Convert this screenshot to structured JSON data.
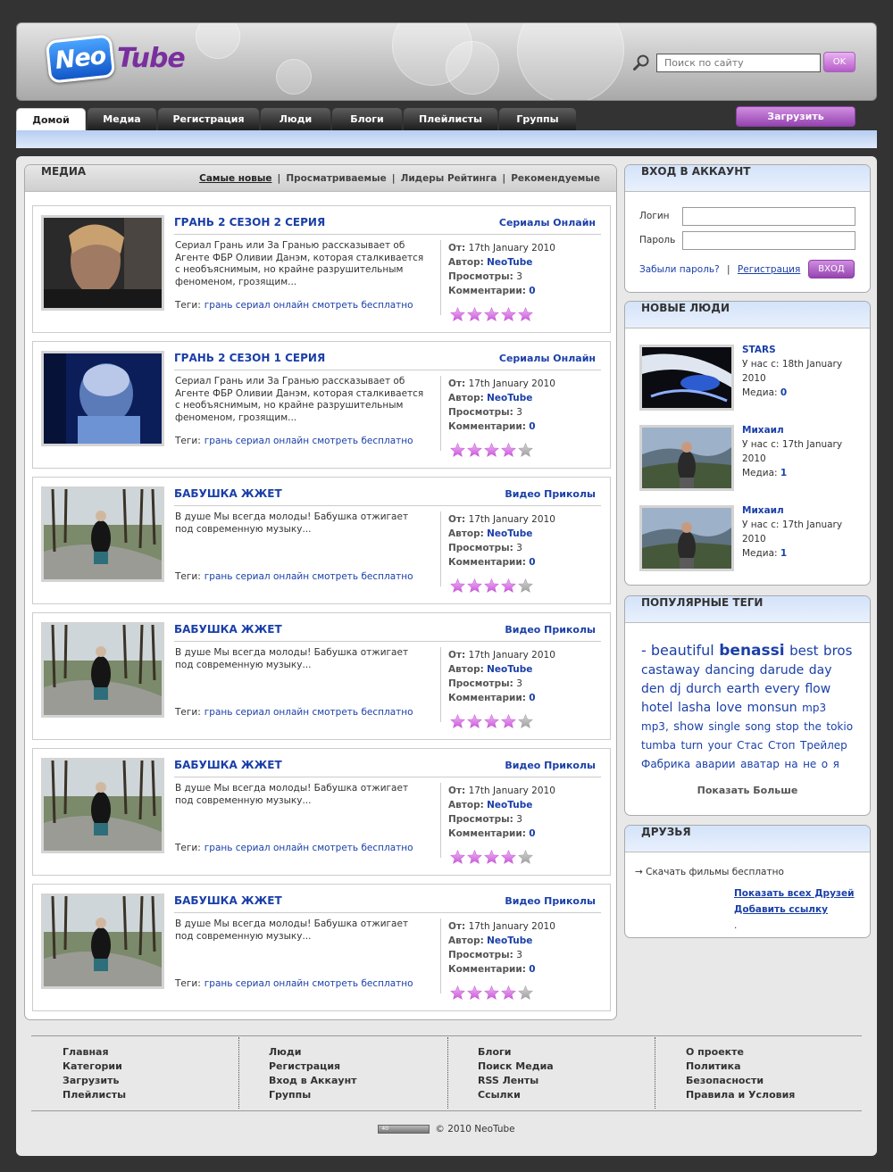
{
  "header": {
    "logo_left": "Neo",
    "logo_right": "Tube",
    "search_placeholder": "Поиск по сайту",
    "search_button": "OK"
  },
  "nav": {
    "tabs": [
      "Домой",
      "Медиа",
      "Регистрация",
      "Люди",
      "Блоги",
      "Плейлисты",
      "Группы"
    ],
    "active": "Домой",
    "upload_button": "Загрузить"
  },
  "media": {
    "title": "МЕДИА",
    "sorts": [
      "Самые новые",
      "Просматриваемые",
      "Лидеры Рейтинга",
      "Рекомендуемые"
    ],
    "labels": {
      "from": "От:",
      "author": "Автор:",
      "views": "Просмотры:",
      "comments": "Комментарии:",
      "tags": "Теги:"
    },
    "items": [
      {
        "title": "ГРАНЬ 2 СЕЗОН 2 СЕРИЯ",
        "category": "Сериалы Онлайн",
        "description": "Сериал Грань или За Гранью рассказывает об Агенте ФБР Оливии Данэм, которая сталкивается с необъяснимым, но крайне разрушительным феноменом, грозящим...",
        "tags": "грань сериал онлайн смотреть бесплатно",
        "date": "17th January 2010",
        "author": "NeoTube",
        "views": "3",
        "comments": "0",
        "rating": 5,
        "thumb": "face-dark"
      },
      {
        "title": "ГРАНЬ 2 СЕЗОН 1 СЕРИЯ",
        "category": "Сериалы Онлайн",
        "description": "Сериал Грань или За Гранью рассказывает об Агенте ФБР Оливии Данэм, которая сталкивается с необъяснимым, но крайне разрушительным феноменом, грозящим...",
        "tags": "грань сериал онлайн смотреть бесплатно",
        "date": "17th January 2010",
        "author": "NeoTube",
        "views": "3",
        "comments": "0",
        "rating": 4,
        "thumb": "face-blue"
      },
      {
        "title": "БАБУШКА ЖЖЕТ",
        "category": "Видео Приколы",
        "description": "В душе Мы всегда молоды! Бабушка отжигает под современную музыку...",
        "tags": "грань сериал онлайн смотреть бесплатно",
        "date": "17th January 2010",
        "author": "NeoTube",
        "views": "3",
        "comments": "0",
        "rating": 4,
        "thumb": "park"
      },
      {
        "title": "БАБУШКА ЖЖЕТ",
        "category": "Видео Приколы",
        "description": "В душе Мы всегда молоды! Бабушка отжигает под современную музыку...",
        "tags": "грань сериал онлайн смотреть бесплатно",
        "date": "17th January 2010",
        "author": "NeoTube",
        "views": "3",
        "comments": "0",
        "rating": 4,
        "thumb": "park"
      },
      {
        "title": "БАБУШКА ЖЖЕТ",
        "category": "Видео Приколы",
        "description": "В душе Мы всегда молоды! Бабушка отжигает под современную музыку...",
        "tags": "грань сериал онлайн смотреть бесплатно",
        "date": "17th January 2010",
        "author": "NeoTube",
        "views": "3",
        "comments": "0",
        "rating": 4,
        "thumb": "park"
      },
      {
        "title": "БАБУШКА ЖЖЕТ",
        "category": "Видео Приколы",
        "description": "В душе Мы всегда молоды! Бабушка отжигает под современную музыку...",
        "tags": "грань сериал онлайн смотреть бесплатно",
        "date": "17th January 2010",
        "author": "NeoTube",
        "views": "3",
        "comments": "0",
        "rating": 4,
        "thumb": "park"
      }
    ]
  },
  "login": {
    "title": "ВХОД В АККАУНТ",
    "login_label": "Логин",
    "password_label": "Пароль",
    "forgot": "Забыли пароль?",
    "register": "Регистрация",
    "enter_button": "ВХОД"
  },
  "people": {
    "title": "НОВЫЕ ЛЮДИ",
    "since_label": "У нас с:",
    "media_label": "Медиа:",
    "list": [
      {
        "name": "STARS",
        "since": "18th January 2010",
        "media": "0",
        "thumb": "abstract"
      },
      {
        "name": "Михаил",
        "since": "17th January 2010",
        "media": "1",
        "thumb": "mountain"
      },
      {
        "name": "Михаил",
        "since": "17th January 2010",
        "media": "1",
        "thumb": "mountain"
      }
    ]
  },
  "tags": {
    "title": "ПОПУЛЯРНЫЕ ТЕГИ",
    "cloud": [
      {
        "t": "- beautiful",
        "s": 16
      },
      {
        "t": "benassi",
        "s": 17,
        "b": true
      },
      {
        "t": "best",
        "s": 15
      },
      {
        "t": "bros",
        "s": 15
      },
      {
        "t": "castaway",
        "s": 14
      },
      {
        "t": "dancing",
        "s": 14
      },
      {
        "t": "darude",
        "s": 14
      },
      {
        "t": "day",
        "s": 14
      },
      {
        "t": "den",
        "s": 14
      },
      {
        "t": "dj",
        "s": 14
      },
      {
        "t": "durch",
        "s": 14
      },
      {
        "t": "earth",
        "s": 14
      },
      {
        "t": "every",
        "s": 14
      },
      {
        "t": "flow",
        "s": 14
      },
      {
        "t": "hotel",
        "s": 14
      },
      {
        "t": "lasha",
        "s": 14
      },
      {
        "t": "love",
        "s": 14
      },
      {
        "t": "monsun",
        "s": 14
      },
      {
        "t": "mp3",
        "s": 12
      },
      {
        "t": "mp3,",
        "s": 12
      },
      {
        "t": "show",
        "s": 13
      },
      {
        "t": "single",
        "s": 12
      },
      {
        "t": "song",
        "s": 12
      },
      {
        "t": "stop",
        "s": 12
      },
      {
        "t": "the",
        "s": 12
      },
      {
        "t": "tokio",
        "s": 12
      },
      {
        "t": "tumba",
        "s": 12
      },
      {
        "t": "turn",
        "s": 12
      },
      {
        "t": "your",
        "s": 12
      },
      {
        "t": "Стас",
        "s": 12
      },
      {
        "t": "Стоп",
        "s": 12
      },
      {
        "t": "Трейлер",
        "s": 12
      },
      {
        "t": "Фабрика",
        "s": 12
      },
      {
        "t": "аварии",
        "s": 12
      },
      {
        "t": "аватар",
        "s": 12
      },
      {
        "t": "на",
        "s": 12
      },
      {
        "t": "не",
        "s": 12
      },
      {
        "t": "о",
        "s": 12
      },
      {
        "t": "я",
        "s": 12
      }
    ],
    "more": "Показать Больше"
  },
  "friends": {
    "title": "ДРУЗЬЯ",
    "link": "→ Скачать фильмы бесплатно",
    "show_all": "Показать всех Друзей",
    "add_link": "Добавить ссылку",
    "dot": "."
  },
  "footer": {
    "col1": [
      "Главная",
      "Категории",
      "Загрузить",
      "Плейлисты"
    ],
    "col2": [
      "Люди",
      "Регистрация",
      "Вход в Аккаунт",
      "Группы"
    ],
    "col3": [
      "Блоги",
      "Поиск Медиа",
      "RSS Ленты",
      "Ссылки"
    ],
    "col4": [
      "О проекте",
      "Политика",
      "Безопасности",
      "Правила и Условия"
    ],
    "badge": "40",
    "copyright": "© 2010 NeoTube"
  },
  "colors": {
    "accent": "#1a3fa8",
    "purple": "#a454bd",
    "star_on": "#c85ad8",
    "star_off": "#a0a0a0"
  }
}
